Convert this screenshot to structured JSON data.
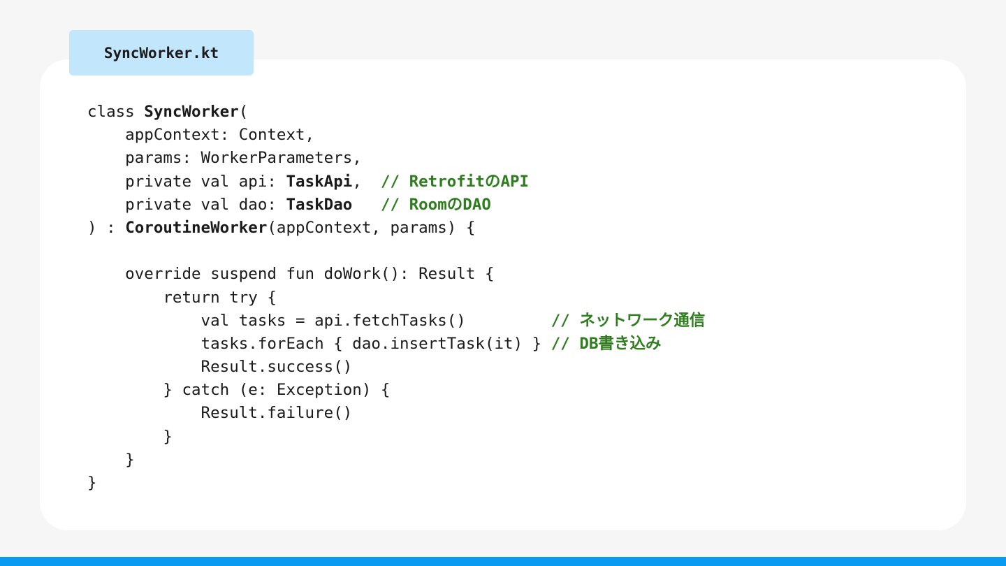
{
  "file_tab": {
    "label": "SyncWorker.kt"
  },
  "code_lines": [
    [
      {
        "t": "class "
      },
      {
        "t": "SyncWorker",
        "s": "b"
      },
      {
        "t": "("
      }
    ],
    [
      {
        "t": "    appContext: Context,"
      }
    ],
    [
      {
        "t": "    params: WorkerParameters,"
      }
    ],
    [
      {
        "t": "    private val api: "
      },
      {
        "t": "TaskApi",
        "s": "b"
      },
      {
        "t": ",  "
      },
      {
        "t": "// RetrofitのAPI",
        "s": "c"
      }
    ],
    [
      {
        "t": "    private val dao: "
      },
      {
        "t": "TaskDao",
        "s": "b"
      },
      {
        "t": "   "
      },
      {
        "t": "// RoomのDAO",
        "s": "c"
      }
    ],
    [
      {
        "t": ") : "
      },
      {
        "t": "CoroutineWorker",
        "s": "b"
      },
      {
        "t": "(appContext, params) {"
      }
    ],
    [
      {
        "t": ""
      }
    ],
    [
      {
        "t": "    override suspend fun doWork(): Result {"
      }
    ],
    [
      {
        "t": "        return try {"
      }
    ],
    [
      {
        "t": "            val tasks = api.fetchTasks()         "
      },
      {
        "t": "// ネットワーク通信",
        "s": "c"
      }
    ],
    [
      {
        "t": "            tasks.forEach { dao.insertTask(it) } "
      },
      {
        "t": "// DB書き込み",
        "s": "c"
      }
    ],
    [
      {
        "t": "            Result.success()"
      }
    ],
    [
      {
        "t": "        } catch (e: Exception) {"
      }
    ],
    [
      {
        "t": "            Result.failure()"
      }
    ],
    [
      {
        "t": "        }"
      }
    ],
    [
      {
        "t": "    }"
      }
    ],
    [
      {
        "t": "}"
      }
    ]
  ],
  "colors": {
    "background": "#f6f6f6",
    "card": "#ffffff",
    "tab": "#c2e6fc",
    "comment": "#2f7d1f",
    "accent_bar": "#0a9af2"
  }
}
